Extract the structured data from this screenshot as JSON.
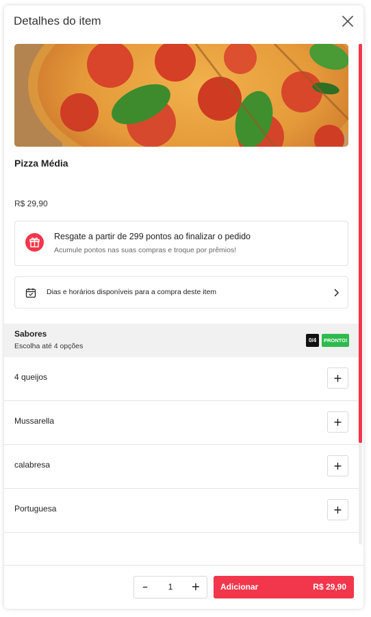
{
  "modal": {
    "title": "Detalhes do item"
  },
  "product": {
    "image_alt": "pizza-photo",
    "name": "Pizza Média",
    "price": "R$ 29,90"
  },
  "points": {
    "title": "Resgate a partir de 299 pontos ao finalizar o pedido",
    "subtitle": "Acumule pontos nas suas compras e troque por prêmios!",
    "icon": "gift-icon"
  },
  "schedule": {
    "label": "Dias e horários disponíveis para a compra deste item",
    "icon": "calendar-icon"
  },
  "flavors": {
    "title": "Sabores",
    "subtitle": "Escolha até 4 opções",
    "count_badge": "0/4",
    "status_badge": "PRONTO!",
    "options": [
      {
        "label": "4 queijos"
      },
      {
        "label": "Mussarella"
      },
      {
        "label": "calabresa"
      },
      {
        "label": "Portuguesa"
      }
    ],
    "add_symbol": "+"
  },
  "footer": {
    "minus_symbol": "–",
    "plus_symbol": "+",
    "quantity": "1",
    "add_label": "Adicionar",
    "add_price": "R$ 29,90"
  },
  "colors": {
    "accent": "#f2364b",
    "ready": "#2dbb4b"
  }
}
